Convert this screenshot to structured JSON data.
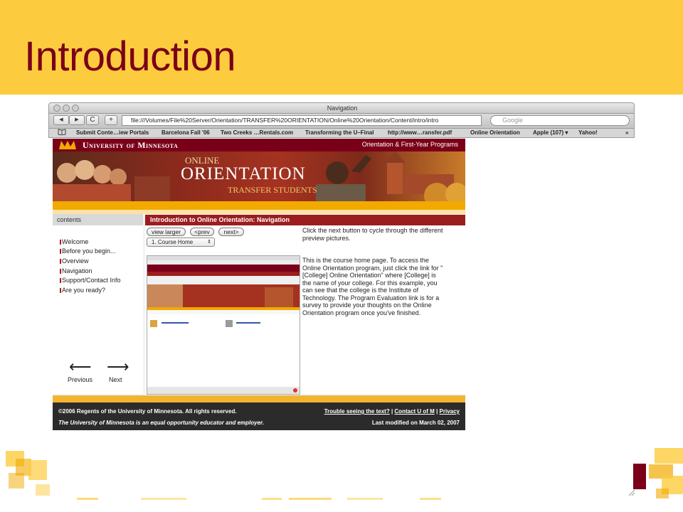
{
  "slide": {
    "title": "Introduction"
  },
  "browser": {
    "window_title": "Navigation",
    "url": "file:///Volumes/File%20Server/Orientation/TRANSFER%20ORIENTATION/Online%20Orientation/Content/intro/intro",
    "search_placeholder": "Google",
    "back_glyph": "◀",
    "forward_glyph": "▶",
    "reload_glyph": "C",
    "add_glyph": "+",
    "bookmarks": [
      "Submit Conte…iew Portals",
      "Barcelona Fall '06",
      "Two Creeks …Rentals.com",
      "Transforming the U–Final",
      "http://www…ransfer.pdf",
      "Online Orientation",
      "Apple (107) ▾",
      "Yahoo!"
    ],
    "more_glyph": "»"
  },
  "site": {
    "university_name": "University of Minnesota",
    "programs_label": "Orientation & First-Year Programs",
    "hero_online": "ONLINE",
    "hero_orientation": "ORIENTATION",
    "hero_transfer": "TRANSFER STUDENTS"
  },
  "sidebar": {
    "heading": "contents",
    "items": [
      "Welcome",
      "Before you begin...",
      "Overview",
      "Navigation",
      "Support/Contact Info",
      "Are you ready?"
    ],
    "previous_label": "Previous",
    "next_label": "Next",
    "left_arrow": "⟵",
    "right_arrow": "⟶"
  },
  "main": {
    "heading": "Introduction to Online Orientation: Navigation",
    "view_larger": "view larger",
    "prev": "<prev",
    "next": "next>",
    "select_value": "1. Course Home",
    "hint": "Click the next button to cycle through the different preview pictures.",
    "description": "This is the course home page. To access the Online Orientation program, just click the link for \"[College] Online Orientation\" where [College] is the name of your college. For this example, you can see that the college is the Institute of Technology. The Program Evaluation link is for a survey to provide your thoughts on the Online Orientation program once you've finished."
  },
  "footer": {
    "copyright": "©2006 Regents of the University of Minnesota. All rights reserved.",
    "eeo": "The University of Minnesota is an equal opportunity educator and employer.",
    "link1": "Trouble seeing the text?",
    "link2": "Contact U of M",
    "link3": "Privacy",
    "separator": " | ",
    "modified": "Last modified on March 02, 2007"
  },
  "colors": {
    "gold": "#fdcc3e",
    "maroon": "#7a0019"
  }
}
